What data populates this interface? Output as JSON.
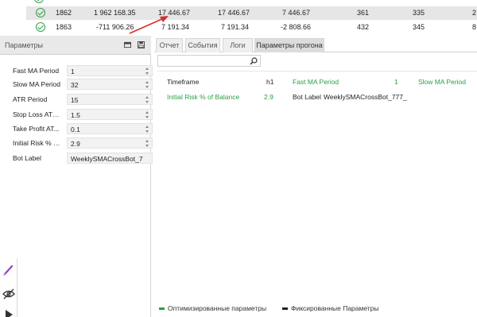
{
  "results": {
    "rows": [
      {
        "id": "1862",
        "net_profit": "1 962 168.35",
        "col3": "17 446.67",
        "col4": "17 446.67",
        "col5": "7 446.67",
        "col6": "361",
        "col7": "335",
        "col8": "2",
        "selected": true
      },
      {
        "id": "1863",
        "net_profit": "-711 906.26",
        "col3": "7 191.34",
        "col4": "7 191.34",
        "col5": "-2 808.66",
        "col6": "432",
        "col7": "345",
        "col8": "8",
        "selected": false
      }
    ]
  },
  "params_panel": {
    "title": "Параметры",
    "items": [
      {
        "label": "Fast MA Period",
        "value": "1"
      },
      {
        "label": "Slow MA Period",
        "value": "32"
      },
      {
        "label": "ATR Period",
        "value": "15"
      },
      {
        "label": "Stop Loss ATR...",
        "value": "1.5"
      },
      {
        "label": "Take Profit AT...",
        "value": "0.1"
      },
      {
        "label": "Initial Risk % o...",
        "value": "2.9"
      },
      {
        "label": "Bot Label",
        "value": "WeeklySMACrossBot_7"
      }
    ]
  },
  "tabs": [
    {
      "label": "Отчет",
      "active": false
    },
    {
      "label": "События",
      "active": false
    },
    {
      "label": "Логи",
      "active": false
    },
    {
      "label": "Параметры прогона",
      "active": true
    }
  ],
  "run_params": {
    "row1": [
      {
        "label": "Timeframe",
        "value": "h1",
        "optimized": false
      },
      {
        "label": "Fast MA Period",
        "value": "1",
        "optimized": true
      },
      {
        "label": "Slow MA Period",
        "value": "",
        "optimized": true
      }
    ],
    "row2": [
      {
        "label": "Initial Risk % of Balance",
        "value": "2.9",
        "optimized": true
      },
      {
        "label": "Bot Label",
        "value": "WeeklySMACrossBot_777_",
        "optimized": false
      }
    ]
  },
  "legend": {
    "optimized": "Оптимизированные параметры",
    "fixed": "Фиксированные Параметры"
  },
  "colors": {
    "optimized": "#2aa043",
    "fixed": "#222222",
    "arrow": "#d32f2f",
    "check": "#31a24c"
  },
  "icons": {
    "row_status": "check-circle-icon",
    "panel_header": [
      "panel-icon",
      "save-icon"
    ],
    "search": "search-icon",
    "tools": [
      "pen-icon",
      "eye-off-icon",
      "play-icon"
    ]
  }
}
